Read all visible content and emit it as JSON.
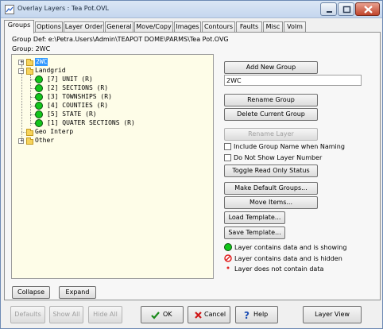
{
  "window": {
    "title": "Overlay Layers : Tea Pot.OVL"
  },
  "tabs": [
    {
      "label": "Groups"
    },
    {
      "label": "Options"
    },
    {
      "label": "Layer Order"
    },
    {
      "label": "General"
    },
    {
      "label": "Move/Copy"
    },
    {
      "label": "Images"
    },
    {
      "label": "Contours"
    },
    {
      "label": "Faults"
    },
    {
      "label": "Misc"
    },
    {
      "label": "Volm"
    }
  ],
  "group_def": "Group Def: e:\\Petra.Users\\Admin\\TEAPOT DOME\\PARMS\\Tea Pot.OVG",
  "current_group": "Group: 2WC",
  "tree": {
    "root_2wc": "2WC",
    "landgrid": "Landgrid",
    "layers": [
      "[7] UNIT   (R)",
      "[2] SECTIONS  (R)",
      "[3] TOWNSHIPS  (R)",
      "[4] COUNTIES  (R)",
      "[5] STATE  (R)",
      "[1] QUATER SECTIONS  (R)"
    ],
    "geo_interp": "Geo Interp",
    "other": "Other"
  },
  "buttons": {
    "add_new_group": "Add New Group",
    "rename_group": "Rename Group",
    "delete_current_group": "Delete Current Group",
    "rename_layer": "Rename Layer",
    "toggle_read_only": "Toggle Read Only Status",
    "make_default_groups": "Make Default Groups...",
    "move_items": "Move Items...",
    "load_template": "Load Template...",
    "save_template": "Save Template...",
    "collapse": "Collapse",
    "expand": "Expand",
    "defaults": "Defaults",
    "show_all": "Show All",
    "hide_all": "Hide All",
    "ok": "OK",
    "cancel": "Cancel",
    "help": "Help",
    "layer_view": "Layer View"
  },
  "group_name_value": "2WC",
  "checkboxes": {
    "include_group_name": "Include Group Name when Naming",
    "do_not_show_layer_number": "Do Not Show Layer Number"
  },
  "legend": {
    "showing": "Layer contains data and is showing",
    "hidden": "Layer contains data and is hidden",
    "no_data": "Layer does not contain data"
  },
  "colors": {
    "layer_showing": "#12c51a",
    "hidden_icon": "#e02020",
    "selection": "#3399ff",
    "tree_bg": "#fefde8"
  }
}
